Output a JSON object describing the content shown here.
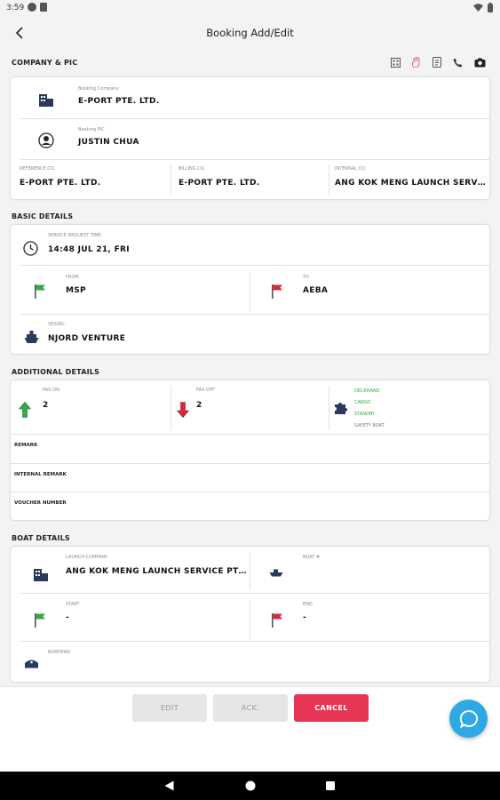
{
  "status": {
    "time": "3:59"
  },
  "appbar": {
    "title": "Booking Add/Edit"
  },
  "company": {
    "section_title": "COMPANY & PIC",
    "booking_company_label": "Booking Company",
    "booking_company": "E-PORT PTE. LTD.",
    "booking_pic_label": "Booking PIC",
    "booking_pic": "JUSTIN CHUA",
    "reference_co_label": "REFERENCE CO.",
    "reference_co": "E-PORT PTE. LTD.",
    "billing_co_label": "BILLING CO.",
    "billing_co": "E-PORT PTE. LTD.",
    "internal_co_label": "INTERNAL CO.",
    "internal_co": "ANG KOK MENG LAUNCH SERVICE PTE. LTD."
  },
  "basic": {
    "section_title": "BASIC DETAILS",
    "service_time_label": "SERVICE REQUEST TIME",
    "service_time": "14:48 JUL 21, FRI",
    "from_label": "FROM",
    "from": "MSP",
    "to_label": "TO",
    "to": "AEBA",
    "vessel_label": "VESSEL",
    "vessel": "NJORD VENTURE"
  },
  "additional": {
    "section_title": "ADDITIONAL DETAILS",
    "pax_on_label": "PAX ON",
    "pax_on": "2",
    "pax_off_label": "PAX OFF",
    "pax_off": "2",
    "options": [
      "DECKHAND",
      "CARGO",
      "STANDBY",
      "SAFETY BOAT"
    ],
    "remark_label": "REMARK",
    "internal_remark_label": "INTERNAL REMARK",
    "voucher_label": "VOUCHER NUMBER"
  },
  "boat": {
    "section_title": "BOAT DETAILS",
    "launch_company_label": "LAUNCH COMPANY",
    "launch_company": "ANG KOK MENG LAUNCH SERVICE PTE. LTD.",
    "boat_label": "BOAT #",
    "start_label": "START",
    "start": "-",
    "end_label": "END",
    "end": "-",
    "boatman_label": "BOATMAN"
  },
  "actions": {
    "edit": "EDIT",
    "ack": "ACK.",
    "cancel": "CANCEL"
  },
  "colors": {
    "accent_red": "#e63555",
    "fab_blue": "#2fa8e6",
    "flag_green": "#3aa64a",
    "flag_red": "#d8283f"
  }
}
